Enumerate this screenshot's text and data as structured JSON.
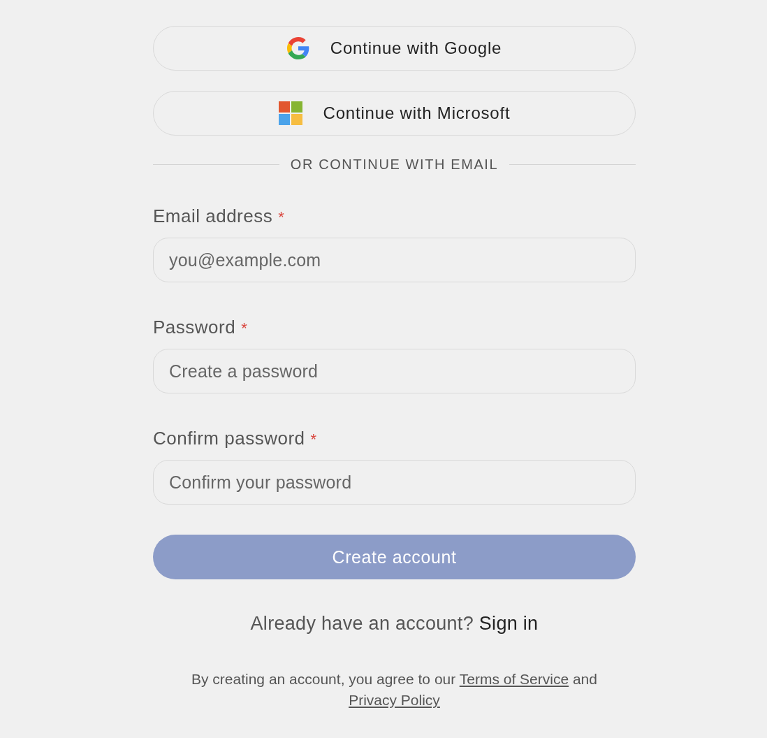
{
  "sso_buttons": [
    {
      "kind": "google",
      "label": "Continue with Google"
    },
    {
      "kind": "microsoft",
      "label": "Continue with Microsoft"
    }
  ],
  "divider": {
    "label": "OR CONTINUE WITH EMAIL"
  },
  "fields": [
    {
      "label": "Email address",
      "required_mark": "*",
      "placeholder": "you@example.com"
    },
    {
      "label": "Password",
      "required_mark": "*",
      "placeholder": "Create a password"
    },
    {
      "label": "Confirm password",
      "required_mark": "*",
      "placeholder": "Confirm your password"
    }
  ],
  "submit": {
    "label": "Create account",
    "disabled": true
  },
  "signin_prompt": {
    "text": "Already have an account?",
    "link": "Sign in"
  },
  "terms": {
    "parts": [
      {
        "kind": "text",
        "text": "By creating an account, you agree to our"
      },
      {
        "kind": "link",
        "text": "Terms of Service"
      },
      {
        "kind": "text",
        "text": "and"
      },
      {
        "kind": "link",
        "text": "Privacy Policy"
      }
    ]
  }
}
